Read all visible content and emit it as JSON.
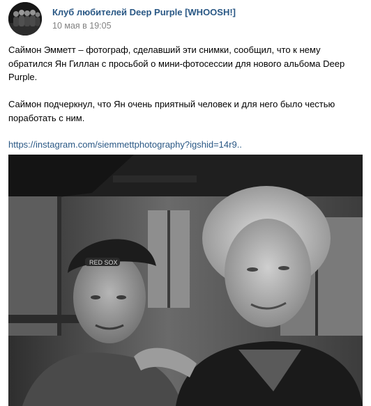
{
  "post": {
    "group_name": "Клуб любителей Deep Purple [WHOOSH!]",
    "date": "10 мая в 19:05",
    "paragraph1": "Саймон Эмметт – фотограф, сделавший эти снимки, сообщил, что к нему обратился Ян Гиллан с просьбой о мини-фотосессии для нового альбома Deep Purple.",
    "paragraph2": "Саймон подчеркнул, что Ян очень приятный человек и для него было честью поработать с ним.",
    "link_text": "https://instagram.com/siemmettphotography?igshid=14r9..",
    "photo": {
      "description_icon": "photo-image",
      "cap_text": "RED SOX"
    }
  },
  "colors": {
    "link": "#2a5885",
    "meta": "#828282",
    "text": "#000000",
    "background": "#ffffff"
  }
}
